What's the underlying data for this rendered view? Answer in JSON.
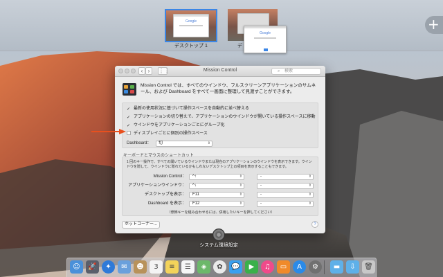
{
  "spaces": {
    "desktop1_label": "デスクトップ 1",
    "desktop2_label": "デ",
    "mini_google": "Google",
    "add_space_icon": "plus-icon"
  },
  "window": {
    "title": "Mission Control",
    "search_placeholder": "検索",
    "nav_back": "‹",
    "nav_forward": "›",
    "description": "Mission Control では、すべてのウインドウ、フルスクリーンアプリケーションのサムネール、および Dashboard をすべて一画面に整理して見渡すことができます。",
    "options": [
      {
        "label": "最新の使用状況に基づいて操作スペースを自動的に並べ替える",
        "checked": true
      },
      {
        "label": "アプリケーションの切り替えで、アプリケーションのウインドウが開いている操作スペースに移動",
        "checked": true
      },
      {
        "label": "ウインドウをアプリケーションごとにグループ化",
        "checked": true
      },
      {
        "label": "ディスプレイごとに個別の操作スペース",
        "checked": false
      }
    ],
    "dashboard_label": "Dashboard：",
    "dashboard_value": "切",
    "shortcut_heading": "キーボードとマウスのショートカット",
    "shortcut_description": "1 回のキー操作で、すべての開いているウインドウまたは現在のアプリケーションのウインドウを表示できます。ウインドウを隠して、ウインドウに隠れているかもしれないデスクトップ上の項目を表示することもできます。",
    "shortcuts": [
      {
        "label": "Mission Control：",
        "key": "^↑",
        "mouse": "-"
      },
      {
        "label": "アプリケーションウインドウ：",
        "key": "^↓",
        "mouse": "-"
      },
      {
        "label": "デスクトップを表示：",
        "key": "F11",
        "mouse": "-"
      },
      {
        "label": "Dashboard を表示：",
        "key": "F12",
        "mouse": "-"
      }
    ],
    "modifier_note": "（修飾キーを組み合わせるには、併用したいキーを押してください）",
    "hot_corners_button": "ホットコーナー...",
    "help_button": "?"
  },
  "app_label": "システム環境設定",
  "annotation": {
    "arrow_color": "#e8501e"
  },
  "dock": {
    "apps": [
      {
        "name": "finder-icon",
        "glyph": "☺",
        "color": "#4a90d9"
      },
      {
        "name": "launchpad-icon",
        "glyph": "🚀",
        "color": "#5a5f6b"
      },
      {
        "name": "safari-icon",
        "glyph": "✦",
        "color": "#2f7ad8"
      },
      {
        "name": "mail-icon",
        "glyph": "✉",
        "color": "#6aa0dc"
      },
      {
        "name": "contacts-icon",
        "glyph": "☻",
        "color": "#b8925a"
      },
      {
        "name": "calendar-icon",
        "glyph": "3",
        "color": "#f4f4f4"
      },
      {
        "name": "notes-icon",
        "glyph": "≡",
        "color": "#f3d35a"
      },
      {
        "name": "reminders-icon",
        "glyph": "☰",
        "color": "#f6f6f6"
      },
      {
        "name": "maps-icon",
        "glyph": "◈",
        "color": "#6cb86a"
      },
      {
        "name": "photos-icon",
        "glyph": "✿",
        "color": "#eaeaea"
      },
      {
        "name": "messages-icon",
        "glyph": "💬",
        "color": "#3aa0f0"
      },
      {
        "name": "facetime-icon",
        "glyph": "▶",
        "color": "#3ab04a"
      },
      {
        "name": "itunes-icon",
        "glyph": "♫",
        "color": "#f04a8a"
      },
      {
        "name": "ibooks-icon",
        "glyph": "▭",
        "color": "#f08a2a"
      },
      {
        "name": "app-store-icon",
        "glyph": "A",
        "color": "#2a8ae8"
      },
      {
        "name": "system-preferences-icon",
        "glyph": "⚙",
        "color": "#707070"
      },
      {
        "name": "folder-icon",
        "glyph": "▬",
        "color": "#5fb0e8"
      },
      {
        "name": "downloads-folder-icon",
        "glyph": "⇩",
        "color": "#5fb0e8"
      },
      {
        "name": "trash-icon",
        "glyph": "🗑",
        "color": "#c8c8c8"
      }
    ]
  }
}
